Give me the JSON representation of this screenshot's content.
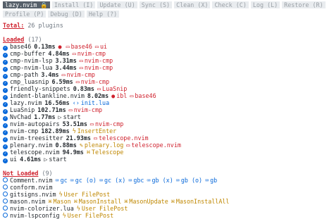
{
  "toolbar": [
    {
      "label": "lazy.nvim 🔒",
      "active": true
    },
    {
      "label": "Install (I)"
    },
    {
      "label": "Update (U)"
    },
    {
      "label": "Sync (S)"
    },
    {
      "label": "Clean (X)"
    },
    {
      "label": "Check (C)"
    },
    {
      "label": "Log (L)"
    },
    {
      "label": "Restore (R)"
    },
    {
      "label": "Profile (P)"
    },
    {
      "label": "Debug (D)"
    },
    {
      "label": "Help (?)"
    }
  ],
  "total": {
    "label": "Total:",
    "value": "26 plugins"
  },
  "loaded": {
    "label": "Loaded",
    "count": "(17)",
    "plugins": [
      {
        "name": "base46",
        "time": "0.13ms",
        "reasons": [
          {
            "type": "bomb",
            "text": ""
          },
          {
            "type": "plugin",
            "text": "base46"
          },
          {
            "type": "plugin",
            "text": "ui"
          }
        ]
      },
      {
        "name": "cmp-buffer",
        "time": "4.84ms",
        "reasons": [
          {
            "type": "plugin",
            "text": "nvim-cmp"
          }
        ]
      },
      {
        "name": "cmp-nvim-lsp",
        "time": "3.31ms",
        "reasons": [
          {
            "type": "plugin",
            "text": "nvim-cmp"
          }
        ]
      },
      {
        "name": "cmp-nvim-lua",
        "time": "3.44ms",
        "reasons": [
          {
            "type": "plugin",
            "text": "nvim-cmp"
          }
        ]
      },
      {
        "name": "cmp-path",
        "time": "3.4ms",
        "reasons": [
          {
            "type": "plugin",
            "text": "nvim-cmp"
          }
        ]
      },
      {
        "name": "cmp_luasnip",
        "time": "6.59ms",
        "reasons": [
          {
            "type": "plugin",
            "text": "nvim-cmp"
          }
        ]
      },
      {
        "name": "friendly-snippets",
        "time": "0.83ms",
        "reasons": [
          {
            "type": "plugin",
            "text": "LuaSnip"
          }
        ]
      },
      {
        "name": "indent-blankline.nvim",
        "time": "8.02ms",
        "reasons": [
          {
            "type": "bomb",
            "text": "ibl"
          },
          {
            "type": "plugin",
            "text": "base46"
          }
        ]
      },
      {
        "name": "lazy.nvim",
        "time": "16.56ms",
        "reasons": [
          {
            "type": "file",
            "text": "init.lua"
          }
        ]
      },
      {
        "name": "LuaSnip",
        "time": "102.71ms",
        "reasons": [
          {
            "type": "plugin",
            "text": "nvim-cmp"
          }
        ]
      },
      {
        "name": "NvChad",
        "time": "1.77ms",
        "reasons": [
          {
            "type": "start",
            "text": "start"
          }
        ]
      },
      {
        "name": "nvim-autopairs",
        "time": "53.51ms",
        "reasons": [
          {
            "type": "plugin",
            "text": "nvim-cmp"
          }
        ]
      },
      {
        "name": "nvim-cmp",
        "time": "182.89ms",
        "reasons": [
          {
            "type": "event",
            "text": "InsertEnter"
          }
        ]
      },
      {
        "name": "nvim-treesitter",
        "time": "21.93ms",
        "reasons": [
          {
            "type": "plugin",
            "text": "telescope.nvim"
          }
        ]
      },
      {
        "name": "plenary.nvim",
        "time": "0.88ms",
        "reasons": [
          {
            "type": "log",
            "text": "plenary.log"
          },
          {
            "type": "plugin",
            "text": "telescope.nvim"
          }
        ]
      },
      {
        "name": "telescope.nvim",
        "time": "94.9ms",
        "reasons": [
          {
            "type": "cmd",
            "text": "Telescope"
          }
        ]
      },
      {
        "name": "ui",
        "time": "4.61ms",
        "reasons": [
          {
            "type": "start",
            "text": "start"
          }
        ]
      }
    ]
  },
  "not_loaded": {
    "label": "Not Loaded",
    "count": "(9)",
    "plugins": [
      {
        "name": "Comment.nvim",
        "reasons": [
          {
            "type": "keys",
            "text": "gc"
          },
          {
            "type": "keys",
            "text": "gc (o)"
          },
          {
            "type": "keys",
            "text": "gc (x)"
          },
          {
            "type": "keys",
            "text": "gbc"
          },
          {
            "type": "keys",
            "text": "gb (x)"
          },
          {
            "type": "keys",
            "text": "gb (o)"
          },
          {
            "type": "keys",
            "text": "gb"
          }
        ]
      },
      {
        "name": "conform.nvim",
        "reasons": []
      },
      {
        "name": "gitsigns.nvim",
        "reasons": [
          {
            "type": "ft",
            "text": "User FilePost"
          }
        ]
      },
      {
        "name": "mason.nvim",
        "reasons": [
          {
            "type": "cmd",
            "text": "Mason"
          },
          {
            "type": "cmd",
            "text": "MasonInstall"
          },
          {
            "type": "cmd",
            "text": "MasonUpdate"
          },
          {
            "type": "cmd",
            "text": "MasonInstallAll"
          }
        ]
      },
      {
        "name": "nvim-colorizer.lua",
        "reasons": [
          {
            "type": "ft",
            "text": "User FilePost"
          }
        ]
      },
      {
        "name": "nvim-lspconfig",
        "reasons": [
          {
            "type": "ft",
            "text": "User FilePost"
          }
        ]
      }
    ]
  }
}
